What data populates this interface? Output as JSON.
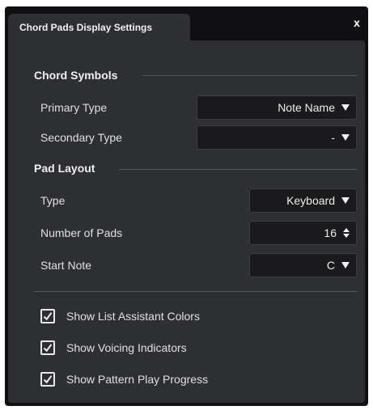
{
  "window": {
    "tab_title": "Chord Pads Display Settings",
    "close_label": "x"
  },
  "chord_symbols": {
    "title": "Chord Symbols",
    "primary_type": {
      "label": "Primary Type",
      "value": "Note Name"
    },
    "secondary_type": {
      "label": "Secondary Type",
      "value": "-"
    }
  },
  "pad_layout": {
    "title": "Pad Layout",
    "type": {
      "label": "Type",
      "value": "Keyboard"
    },
    "number_of_pads": {
      "label": "Number of Pads",
      "value": "16"
    },
    "start_note": {
      "label": "Start Note",
      "value": "C"
    }
  },
  "options": [
    {
      "label": "Show List Assistant Colors",
      "checked": true
    },
    {
      "label": "Show Voicing Indicators",
      "checked": true
    },
    {
      "label": "Show Pattern Play Progress",
      "checked": true
    }
  ],
  "colors": {
    "background": "#2e2f33",
    "field": "#1a1a1c",
    "frame": "#101012",
    "text": "#e6e6e6"
  }
}
